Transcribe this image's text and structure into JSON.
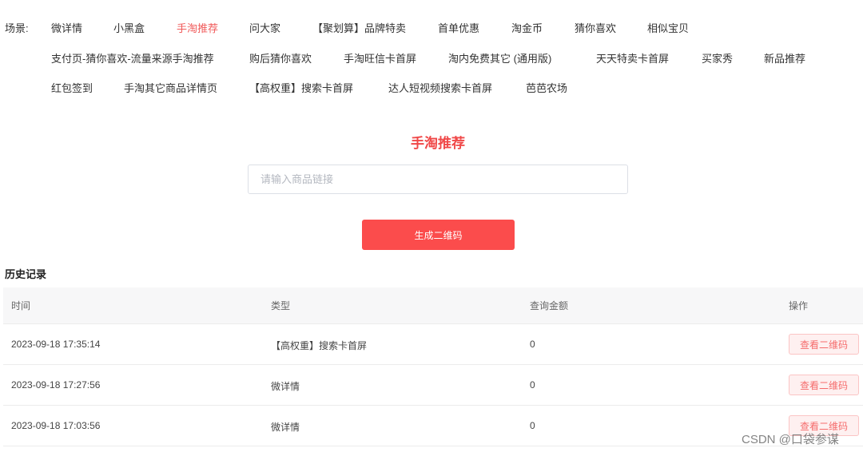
{
  "scene": {
    "label": "场景:",
    "active": "手淘推荐",
    "items": [
      "微详情",
      "小黑盒",
      "手淘推荐",
      "问大家",
      "【聚划算】品牌特卖",
      "首单优惠",
      "淘金币",
      "猜你喜欢",
      "相似宝贝",
      "支付页-猜你喜欢-流量来源手淘推荐",
      "购后猜你喜欢",
      "手淘旺信卡首屏",
      "淘内免费其它 (通用版)",
      "天天特卖卡首屏",
      "买家秀",
      "新品推荐",
      "红包签到",
      "手淘其它商品详情页",
      "【高权重】搜索卡首屏",
      "达人短视频搜索卡首屏",
      "芭芭农场"
    ]
  },
  "main": {
    "title": "手淘推荐",
    "input_placeholder": "请输入商品链接",
    "input_value": "",
    "generate_label": "生成二维码"
  },
  "history": {
    "title": "历史记录",
    "columns": [
      "时间",
      "类型",
      "查询金额",
      "操作"
    ],
    "rows": [
      {
        "time": "2023-09-18 17:35:14",
        "type": "【高权重】搜索卡首屏",
        "amount": "0",
        "action": "查看二维码"
      },
      {
        "time": "2023-09-18 17:27:56",
        "type": "微详情",
        "amount": "0",
        "action": "查看二维码"
      },
      {
        "time": "2023-09-18 17:03:56",
        "type": "微详情",
        "amount": "0",
        "action": "查看二维码"
      }
    ]
  },
  "watermark": "CSDN @口袋参谋",
  "colors": {
    "accent": "#fb4c4c",
    "active_text": "#f05a5a",
    "title": "#f04848"
  }
}
